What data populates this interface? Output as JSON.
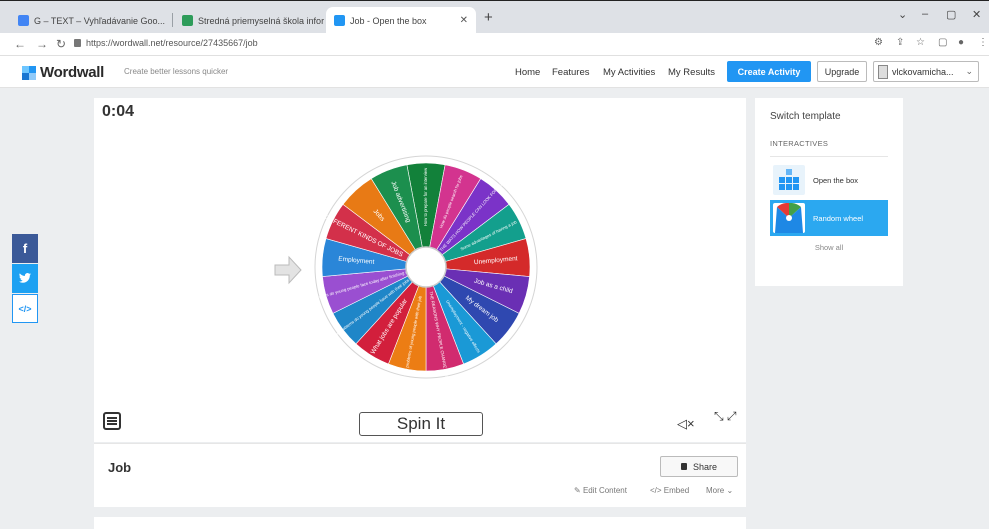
{
  "browser": {
    "tabs": [
      {
        "title": "G – TEXT – Vyhľadávanie Goo...",
        "favicon_color": "#4285f4"
      },
      {
        "title": "Stredná priemyselná škola inform...",
        "favicon_color": "#2e9c5a"
      },
      {
        "title": "Job - Open the box",
        "favicon_color": "#2196f3"
      }
    ],
    "url": "https://wordwall.net/resource/27435667/job",
    "new_tab": "+",
    "minimize": "–",
    "restore": "▢",
    "close": "✕"
  },
  "header": {
    "logo_text": "Wordwall",
    "tagline": "Create better lessons quicker",
    "nav": [
      "Home",
      "Features",
      "My Activities",
      "My Results"
    ],
    "create_label": "Create Activity",
    "upgrade_label": "Upgrade",
    "user_label": "vlckovamicha...",
    "user_chevron": "⌄"
  },
  "social": {
    "facebook": "f",
    "twitter": "t",
    "embed": "</>"
  },
  "activity": {
    "timer": "0:04",
    "spin_label": "Spin It",
    "sound_icon": "◁×",
    "fullscreen_icon": "⤡ ⤢",
    "wheel_segments": [
      {
        "label": "How to prepare for an interview",
        "color": "#12813a"
      },
      {
        "label": "How do people search for jobs",
        "color": "#d3348f"
      },
      {
        "label": "THE WAYS HOW PEOPLE CAN LOOK FOR A JOB",
        "color": "#7b33c8"
      },
      {
        "label": "Some advantages of having a job",
        "color": "#139f8d"
      },
      {
        "label": "Unemployment",
        "color": "#d42a2a"
      },
      {
        "label": "Job as a child",
        "color": "#6a2fb4"
      },
      {
        "label": "My dream job",
        "color": "#2f48b0"
      },
      {
        "label": "Unemployment - negative effects",
        "color": "#1a99d6"
      },
      {
        "label": "THE REASONS WHY PEOPLE CHANGE JOBS",
        "color": "#d12b6f"
      },
      {
        "label": "The problems of young people with their job",
        "color": "#ec7d14"
      },
      {
        "label": "What jobs are popular",
        "color": "#d21f3c"
      },
      {
        "label": "What problems do young people have with their jobs",
        "color": "#1f86c8"
      },
      {
        "label": "What difficulties do young people face today after finishing school",
        "color": "#9a4fd1"
      },
      {
        "label": "Employment",
        "color": "#2a86d8"
      },
      {
        "label": "DIFFERENT KINDS OF JOBS",
        "color": "#d3304a"
      },
      {
        "label": "Jobs",
        "color": "#e87a15"
      },
      {
        "label": "Job advertising",
        "color": "#1c8f4e"
      }
    ]
  },
  "info": {
    "title": "Job",
    "share_label": "Share",
    "edit_label": "Edit Content",
    "embed_label": "Embed",
    "more_label": "More ⌄"
  },
  "templates": {
    "title": "Switch template",
    "section": "INTERACTIVES",
    "items": [
      {
        "label": "Open the box"
      },
      {
        "label": "Random wheel"
      }
    ],
    "show_all": "Show all"
  }
}
